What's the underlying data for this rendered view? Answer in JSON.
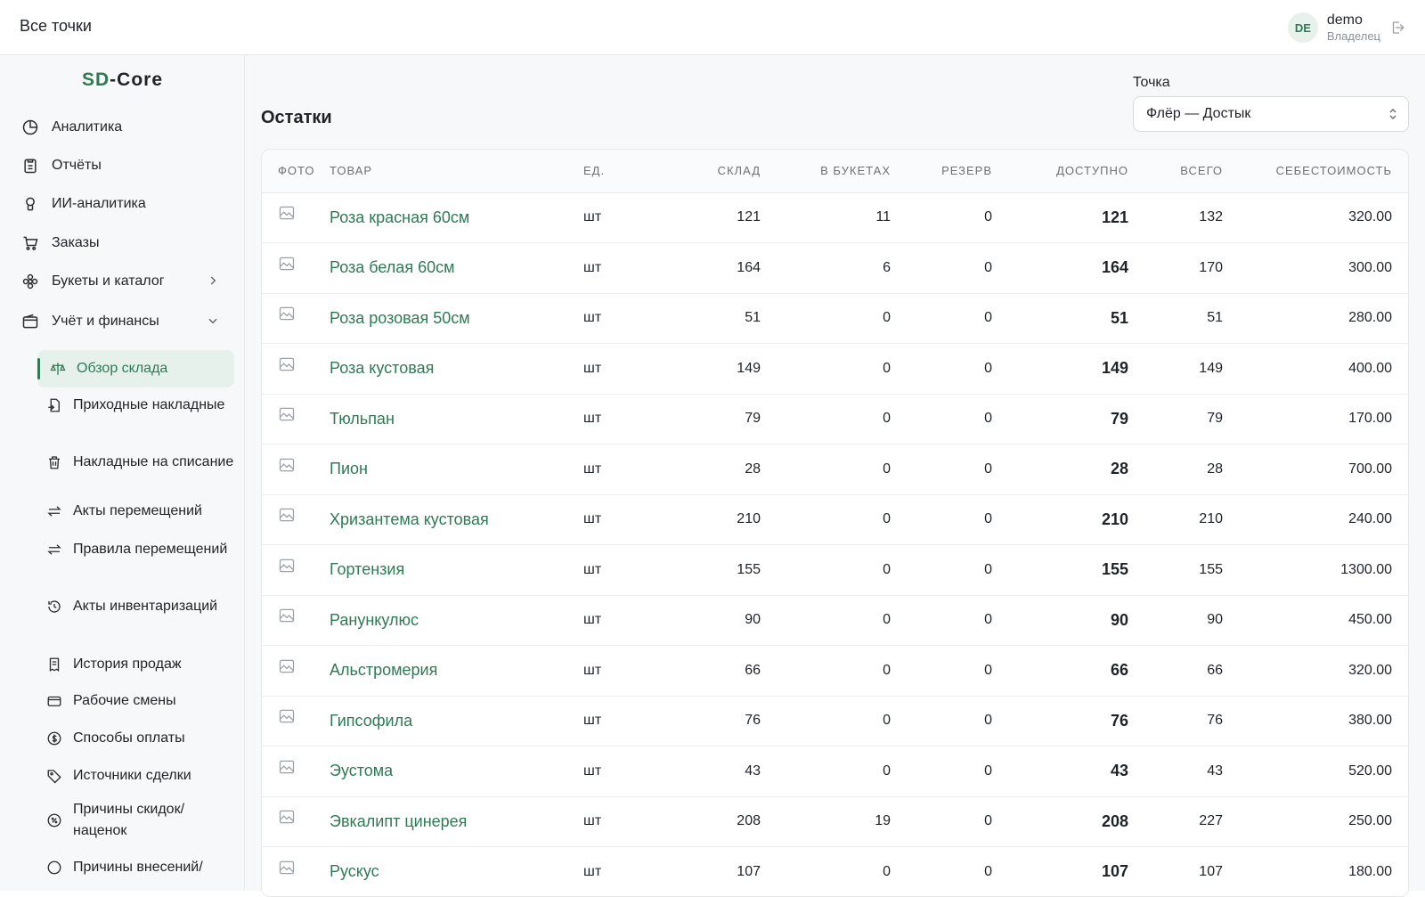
{
  "header": {
    "breadcrumb": "Все точки",
    "user": {
      "initials": "DE",
      "name": "demo",
      "role": "Владелец"
    }
  },
  "sidebar": {
    "brand_accent": "SD",
    "brand_rest": "-Core",
    "items": [
      {
        "label": "Аналитика",
        "icon": "pie-chart-icon"
      },
      {
        "label": "Отчёты",
        "icon": "clipboard-icon"
      },
      {
        "label": "ИИ-аналитика",
        "icon": "ai-chip-icon"
      },
      {
        "label": "Заказы",
        "icon": "cart-icon"
      },
      {
        "label": "Букеты и каталог",
        "icon": "flower-icon"
      },
      {
        "label": "Учёт и финансы",
        "icon": "wallet-icon"
      }
    ],
    "subitems": [
      {
        "label": "Обзор склада",
        "icon": "scale-icon"
      },
      {
        "label": "Приходные накладные",
        "icon": "file-import-icon"
      },
      {
        "label": "Накладные на списание",
        "icon": "trash-icon"
      },
      {
        "label": "Акты перемещений",
        "icon": "transfer-icon"
      },
      {
        "label": "Правила перемещений",
        "icon": "transfer-icon"
      },
      {
        "label": "Акты инвентаризаций",
        "icon": "history-icon"
      },
      {
        "label": "История продаж",
        "icon": "receipt-icon"
      },
      {
        "label": "Рабочие смены",
        "icon": "card-icon"
      },
      {
        "label": "Способы оплаты",
        "icon": "coin-icon"
      },
      {
        "label": "Источники сделки",
        "icon": "tag-icon"
      },
      {
        "label": "Причины скидок/ наценок",
        "icon": "percent-icon"
      },
      {
        "label": "Причины внесений/",
        "icon": "cash-icon"
      }
    ]
  },
  "main": {
    "title": "Остатки",
    "point_label": "Точка",
    "point_value": "Флёр — Достык",
    "columns": [
      "Фото",
      "Товар",
      "Ед.",
      "Склад",
      "В букетах",
      "Резерв",
      "Доступно",
      "Всего",
      "Себестоимость"
    ],
    "rows": [
      {
        "name": "Роза красная 60см",
        "unit": "шт",
        "stock": "121",
        "bouquets": "11",
        "reserve": "0",
        "available": "121",
        "total": "132",
        "cost": "320.00"
      },
      {
        "name": "Роза белая 60см",
        "unit": "шт",
        "stock": "164",
        "bouquets": "6",
        "reserve": "0",
        "available": "164",
        "total": "170",
        "cost": "300.00"
      },
      {
        "name": "Роза розовая 50см",
        "unit": "шт",
        "stock": "51",
        "bouquets": "0",
        "reserve": "0",
        "available": "51",
        "total": "51",
        "cost": "280.00"
      },
      {
        "name": "Роза кустовая",
        "unit": "шт",
        "stock": "149",
        "bouquets": "0",
        "reserve": "0",
        "available": "149",
        "total": "149",
        "cost": "400.00"
      },
      {
        "name": "Тюльпан",
        "unit": "шт",
        "stock": "79",
        "bouquets": "0",
        "reserve": "0",
        "available": "79",
        "total": "79",
        "cost": "170.00"
      },
      {
        "name": "Пион",
        "unit": "шт",
        "stock": "28",
        "bouquets": "0",
        "reserve": "0",
        "available": "28",
        "total": "28",
        "cost": "700.00"
      },
      {
        "name": "Хризантема кустовая",
        "unit": "шт",
        "stock": "210",
        "bouquets": "0",
        "reserve": "0",
        "available": "210",
        "total": "210",
        "cost": "240.00"
      },
      {
        "name": "Гортензия",
        "unit": "шт",
        "stock": "155",
        "bouquets": "0",
        "reserve": "0",
        "available": "155",
        "total": "155",
        "cost": "1300.00"
      },
      {
        "name": "Ранункулюс",
        "unit": "шт",
        "stock": "90",
        "bouquets": "0",
        "reserve": "0",
        "available": "90",
        "total": "90",
        "cost": "450.00"
      },
      {
        "name": "Альстромерия",
        "unit": "шт",
        "stock": "66",
        "bouquets": "0",
        "reserve": "0",
        "available": "66",
        "total": "66",
        "cost": "320.00"
      },
      {
        "name": "Гипсофила",
        "unit": "шт",
        "stock": "76",
        "bouquets": "0",
        "reserve": "0",
        "available": "76",
        "total": "76",
        "cost": "380.00"
      },
      {
        "name": "Эустома",
        "unit": "шт",
        "stock": "43",
        "bouquets": "0",
        "reserve": "0",
        "available": "43",
        "total": "43",
        "cost": "520.00"
      },
      {
        "name": "Эвкалипт цинерея",
        "unit": "шт",
        "stock": "208",
        "bouquets": "19",
        "reserve": "0",
        "available": "208",
        "total": "227",
        "cost": "250.00"
      },
      {
        "name": "Рускус",
        "unit": "шт",
        "stock": "107",
        "bouquets": "0",
        "reserve": "0",
        "available": "107",
        "total": "107",
        "cost": "180.00"
      }
    ]
  },
  "colors": {
    "accent": "#2f7a55",
    "accent_bg": "#e7f1eb",
    "muted": "#6b7178"
  }
}
